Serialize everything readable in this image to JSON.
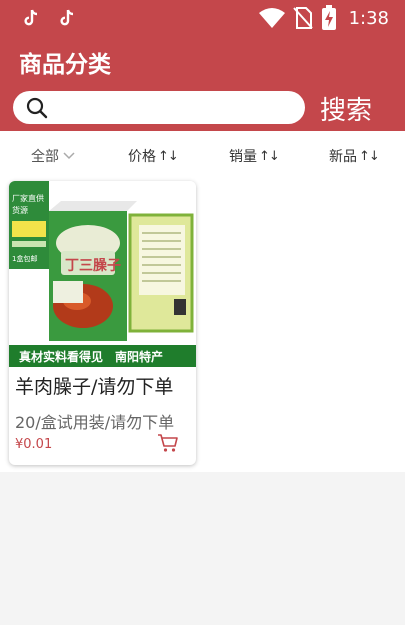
{
  "status_bar": {
    "time": "1:38",
    "icons": [
      "tiktok-icon",
      "tiktok-icon",
      "wifi-icon",
      "no-sim-icon",
      "battery-charging-icon"
    ]
  },
  "header": {
    "title": "商品分类",
    "search_placeholder": "",
    "search_button": "搜索"
  },
  "sort_bar": {
    "items": [
      {
        "label": "全部",
        "indicator": "chevron-down"
      },
      {
        "label": "价格",
        "indicator": "↑↓"
      },
      {
        "label": "销量",
        "indicator": "↑↓"
      },
      {
        "label": "新品",
        "indicator": "↑↓"
      }
    ]
  },
  "products": [
    {
      "name": "羊肉臊子/请勿下单",
      "description": "20/盒试用装/请勿下单",
      "price": "¥0.01",
      "image": {
        "banner": "真材实料看得见　南阳特产",
        "side_text_1": "厂家直供",
        "side_text_2": "货源",
        "side_text_3": "1盒包邮",
        "box_text": "丁三臊子"
      }
    }
  ],
  "colors": {
    "primary": "#c4474b",
    "price": "#c4474b",
    "background": "#f4f4f4"
  }
}
